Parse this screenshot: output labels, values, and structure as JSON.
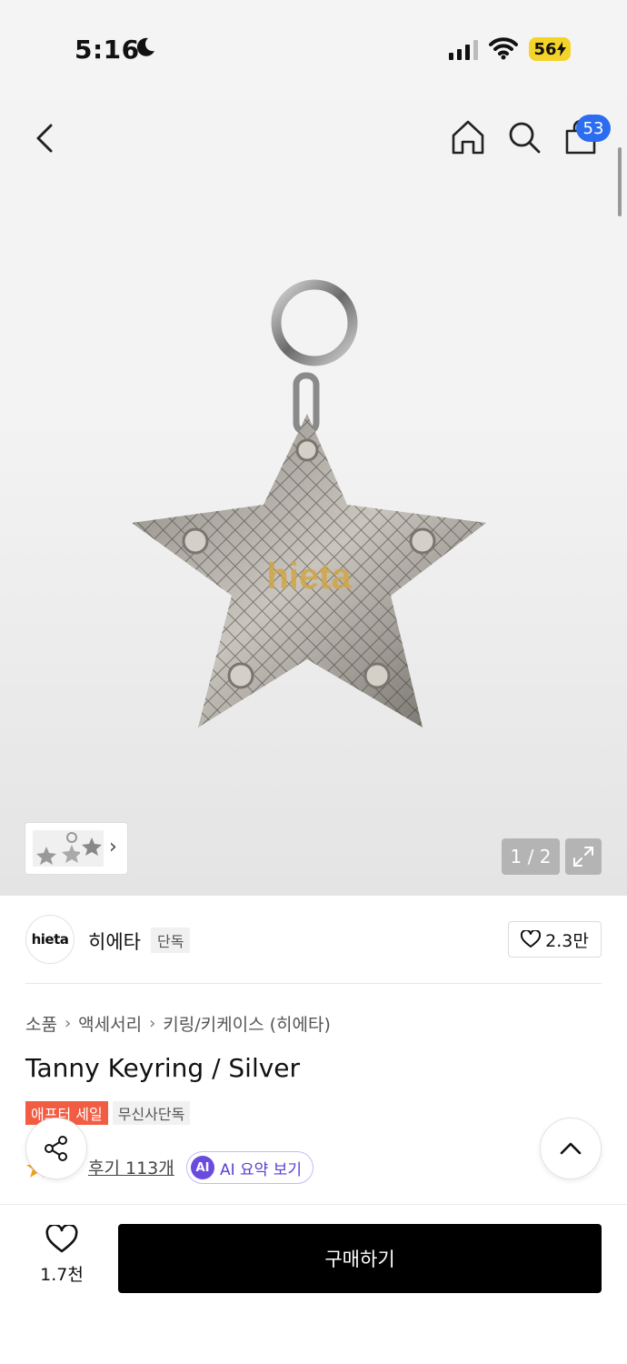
{
  "status_bar": {
    "time": "5:16",
    "battery": "56"
  },
  "nav": {
    "cart_count": "53"
  },
  "gallery": {
    "page_counter": "1 / 2",
    "watermark": "hieta"
  },
  "brand": {
    "logo_text": "hieta",
    "name": "히에타",
    "tag": "단독",
    "likes": "2.3만"
  },
  "breadcrumb": [
    "소품",
    "액세서리",
    "키링/키케이스 (히에타)"
  ],
  "product": {
    "title": "Tanny Keyring / Silver",
    "tags": [
      "애프터 세일",
      "무신사단독"
    ],
    "reviews": "후기 113개",
    "ai_badge": "AI",
    "ai_summary": "AI 요약 보기"
  },
  "bottom": {
    "wish_count": "1.7천",
    "buy_label": "구매하기"
  },
  "colors": {
    "accent_blue": "#2c6cf0",
    "sale_red": "#f25c42",
    "ai_purple": "#6a4be0"
  }
}
